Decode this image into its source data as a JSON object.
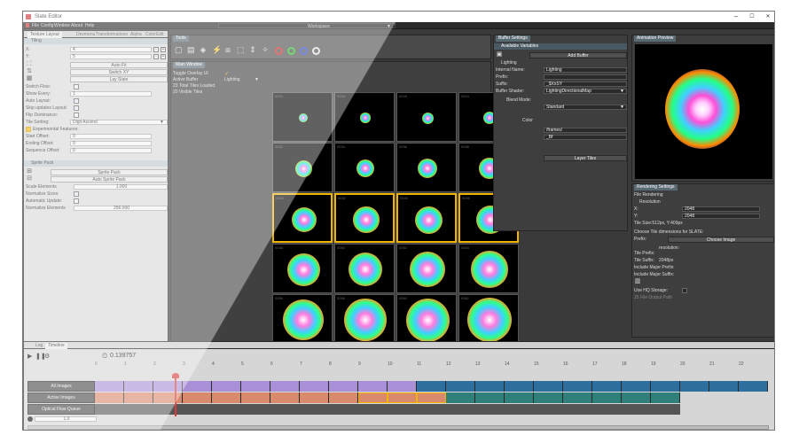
{
  "window": {
    "title": "Slate Editor",
    "min": "–",
    "max": "☐",
    "close": "✕"
  },
  "menu": {
    "items": [
      "File",
      "Config",
      "Window",
      "About",
      "Help"
    ],
    "workspace": "Workspace"
  },
  "left_panel": {
    "tabs": [
      "Texture Layout",
      "Devmenu",
      "Transformations",
      "Alpha",
      "ColorEdit"
    ],
    "tiling": {
      "header": "Tiling",
      "x_label": "X:",
      "x_value": "4",
      "y_label": "Y:",
      "y_value": "5",
      "auto_fit": "Auto Fit",
      "switch_xy": "Switch XY",
      "lay_slate": "Lay Slate",
      "switch_flow": "Switch Flow:",
      "show_every": "Show Every:",
      "show_every_value": "1",
      "auto_layout": "Auto Layout:",
      "skip_updates": "Skip updates Layout:",
      "flip_dominance": "Flip Dominance:",
      "tile_sorting": "Tile Sorting:",
      "tile_sorting_value": "Digit Ascend",
      "experimental": "Experimental Features:",
      "start_offset": "Start Offset:",
      "start_offset_value": "0",
      "ending_offset": "Ending Offset:",
      "ending_offset_value": "0",
      "sequence_offset": "Sequence Offset:",
      "sequence_offset_value": "0"
    },
    "sprite_pack": {
      "header": "Sprite Pack",
      "sprite_pack_btn": "Sprite Pack",
      "auto_sprite_pack_btn": "Auto Sprite Pack",
      "scale_elements": "Scale Elements",
      "scale_elements_value": "1.000",
      "normalize_sizes": "Normalize Sizes:",
      "automatic_update": "Automatic Update:",
      "normalize_elements": "Normalize Elements",
      "normalize_elements_value": "256.000"
    }
  },
  "tools": {
    "tab": "Tools"
  },
  "main_window": {
    "tab": "Main Window",
    "toggle_overlay": "Toggle Overlay UI",
    "active_buffer_label": "Active Buffer",
    "active_buffer_value": "Lighting",
    "tiles_loaded": "23 Total Tiles Loaded",
    "visible_tiles": "20 Visible Tiles",
    "tile_labels": [
      "0024",
      "0016",
      "0026",
      "0024",
      "0032",
      "0034",
      "0036",
      "0038",
      "0040",
      "0042",
      "0044",
      "0046",
      "0048",
      "0050",
      "0052",
      "0054",
      "0056",
      "0058",
      "0060",
      "0062"
    ]
  },
  "buffer_settings": {
    "tab": "Buffer Settings",
    "available_variables": "Available Variables",
    "add_buffer": "Add Buffer",
    "lighting": "Lighting",
    "internal_name": "Internal Name:",
    "internal_name_value": "Lighting",
    "prefix": "Prefix:",
    "suffix": "Suffix:",
    "suffix_value": "_$XxSY",
    "buffer_shader": "Buffer Shader:",
    "buffer_shader_value": "LightingDirectionalMap",
    "blend_mode": "Blend Mode:",
    "blend_mode_value": "Standard",
    "color": "Color",
    "frames": "/frames/",
    "bf": "_Bf",
    "layer_tiles": "Layer Tiles"
  },
  "animation_preview": {
    "tab": "Animation Preview"
  },
  "rendering_settings": {
    "tab": "Rendering Settings",
    "file_rendering": "File Rendering",
    "resolution": "Resolution",
    "x_label": "X:",
    "x_value": "2048",
    "y_label": "Y:",
    "y_value": "2048",
    "tile_size": "Tile Size:512px, Y:409px",
    "choose_tile_dims": "Choose Tile dimensions for SLATE:",
    "prefix": "Prefix:",
    "choose_image": "Choose Image",
    "resolution_label": "resolution:",
    "tile_prefix": "Tile Prefix:",
    "tile_suffix": "Tile Suffix:",
    "tile_suffix_value": "2048px",
    "include_major_prefix": "Include Major Prefix:",
    "include_major_suffix": "Include Major Suffix:",
    "use_hq_storage": "Use HQ Storage:",
    "file_output_path": "25 File Output Path"
  },
  "timeline": {
    "tabs": [
      "Log",
      "Timeline"
    ],
    "time": "0.139757",
    "ticks": [
      "0",
      "1",
      "2",
      "3",
      "4",
      "5",
      "6",
      "7",
      "8",
      "9",
      "10",
      "11",
      "12",
      "13",
      "14",
      "15",
      "16",
      "17",
      "18",
      "19",
      "20",
      "21",
      "22"
    ],
    "rows": [
      "All Images",
      "Active Images",
      "Optical Flow Queue"
    ],
    "speed_value": "1.0"
  },
  "colors": {
    "accent": "#f0b400",
    "purple": "#a98fd6",
    "salmon": "#d98a6c",
    "teal": "#2f7f7a",
    "blue": "#2f6fa0",
    "red_marker": "#d93b3b"
  }
}
